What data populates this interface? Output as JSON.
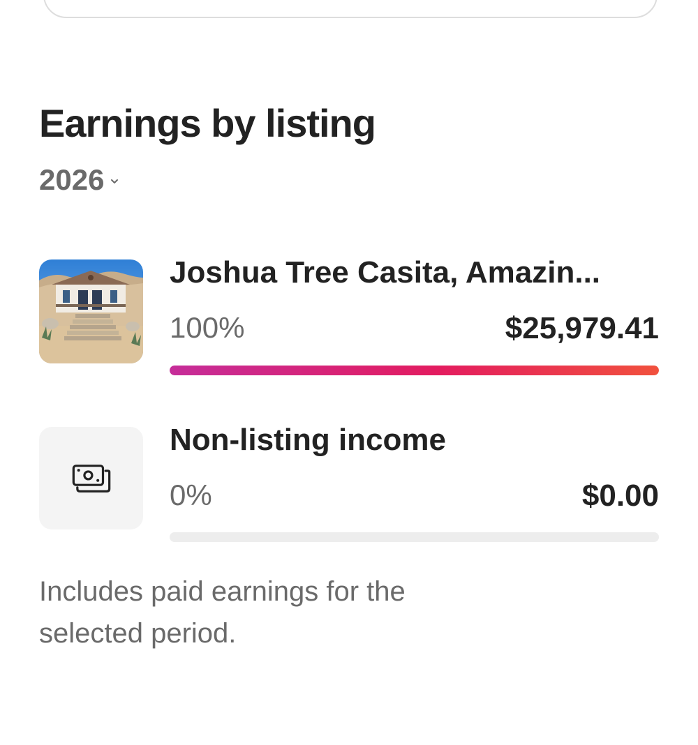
{
  "section": {
    "title": "Earnings by listing",
    "year": "2026"
  },
  "listings": [
    {
      "name": "Joshua Tree Casita, Amazin...",
      "percent": "100%",
      "amount": "$25,979.41",
      "share": 1.0,
      "thumbnail_icon": "house-photo"
    },
    {
      "name": "Non-listing income",
      "percent": "0%",
      "amount": "$0.00",
      "share": 0.0,
      "thumbnail_icon": "cash-icon"
    }
  ],
  "footnote": "Includes paid earnings for the selected period.",
  "colors": {
    "bar_gradient_start": "#c52d99",
    "bar_gradient_mid": "#e31c5f",
    "bar_gradient_end": "#f1513d",
    "bar_track": "#ededed",
    "muted_text": "#6a6a6a",
    "primary_text": "#222222"
  }
}
